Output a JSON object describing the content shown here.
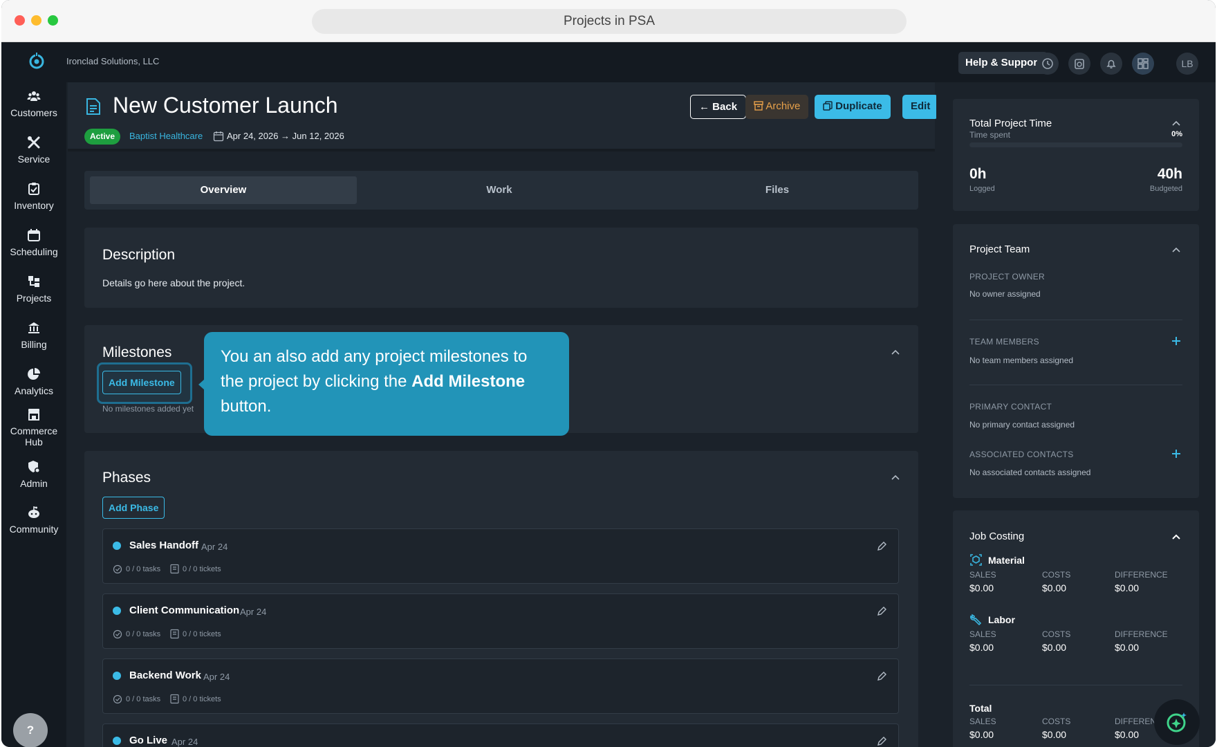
{
  "window": {
    "title": "Projects in PSA"
  },
  "topbar": {
    "org_name": "Ironclad Solutions, LLC",
    "help_label": "Help & Support",
    "avatar_initials": "LB"
  },
  "sidebar": {
    "items": [
      {
        "label": "Customers",
        "icon": "customers-icon"
      },
      {
        "label": "Service",
        "icon": "service-icon"
      },
      {
        "label": "Inventory",
        "icon": "inventory-icon"
      },
      {
        "label": "Scheduling",
        "icon": "calendar-icon"
      },
      {
        "label": "Projects",
        "icon": "projects-icon"
      },
      {
        "label": "Billing",
        "icon": "billing-icon"
      },
      {
        "label": "Analytics",
        "icon": "analytics-icon"
      },
      {
        "label": "Commerce Hub",
        "icon": "commerce-icon"
      },
      {
        "label": "Admin",
        "icon": "admin-icon"
      },
      {
        "label": "Community",
        "icon": "community-icon"
      }
    ],
    "help_glyph": "?"
  },
  "header": {
    "title": "New Customer Launch",
    "status": "Active",
    "customer": "Baptist Healthcare",
    "date_range": "Apr 24, 2026 → Jun 12, 2026",
    "buttons": {
      "back": "Back",
      "archive": "Archive",
      "duplicate": "Duplicate",
      "edit": "Edit"
    }
  },
  "tabs": [
    {
      "label": "Overview"
    },
    {
      "label": "Work"
    },
    {
      "label": "Files"
    }
  ],
  "description": {
    "title": "Description",
    "text": "Details go here about the project."
  },
  "milestones": {
    "title": "Milestones",
    "add_label": "Add Milestone",
    "empty_text": "No milestones added yet"
  },
  "tooltip": {
    "text_before": "You an also add any project milestones to the project by clicking the ",
    "bold": "Add Milestone",
    "text_after": " button."
  },
  "phases": {
    "title": "Phases",
    "add_label": "Add Phase",
    "items": [
      {
        "name": "Sales Handoff",
        "date": "Apr 24",
        "tasks": "0 / 0 tasks",
        "tickets": "0 / 0 tickets"
      },
      {
        "name": "Client Communication",
        "date": "Apr 24",
        "tasks": "0 / 0 tasks",
        "tickets": "0 / 0 tickets"
      },
      {
        "name": "Backend Work",
        "date": "Apr 24",
        "tasks": "0 / 0 tasks",
        "tickets": "0 / 0 tickets"
      },
      {
        "name": "Go Live",
        "date": "Apr 24"
      }
    ]
  },
  "project_time": {
    "title": "Total Project Time",
    "subtitle": "Time spent",
    "percent": "0%",
    "progress": 0,
    "logged_value": "0h",
    "logged_label": "Logged",
    "budgeted_value": "40h",
    "budgeted_label": "Budgeted"
  },
  "team": {
    "title": "Project Team",
    "owner_label": "PROJECT OWNER",
    "owner_value": "No owner assigned",
    "members_label": "TEAM MEMBERS",
    "members_value": "No team members assigned",
    "primary_label": "PRIMARY CONTACT",
    "primary_value": "No primary contact assigned",
    "associated_label": "ASSOCIATED CONTACTS",
    "associated_value": "No associated contacts assigned"
  },
  "job_costing": {
    "title": "Job Costing",
    "col_sales": "SALES",
    "col_costs": "COSTS",
    "col_diff": "DIFFERENCE",
    "col_diff_cut": "DIFFEREN",
    "material": {
      "label": "Material",
      "sales": "$0.00",
      "costs": "$0.00",
      "diff": "$0.00"
    },
    "labor": {
      "label": "Labor",
      "sales": "$0.00",
      "costs": "$0.00",
      "diff": "$0.00"
    },
    "total": {
      "label": "Total",
      "sales": "$0.00",
      "costs": "$0.00",
      "diff": "$0.00"
    }
  },
  "colors": {
    "accent": "#3bbbe7",
    "status_active": "#1e9e3f",
    "archive": "#e8a14a",
    "tooltip": "#2294b8"
  }
}
